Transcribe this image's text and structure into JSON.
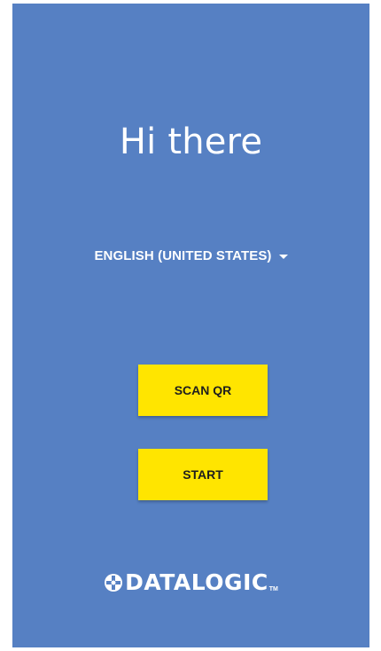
{
  "greeting": {
    "title": "Hi there"
  },
  "language_selector": {
    "value": "ENGLISH (UNITED STATES)"
  },
  "buttons": {
    "scan_qr": "SCAN QR",
    "start": "START"
  },
  "brand": {
    "logo_text": "DATALOGIC",
    "trademark": "TM",
    "icon": "datalogic-logo-mark"
  },
  "colors": {
    "background": "#5680c3",
    "button": "#ffe500",
    "button_text": "#1e1e1e",
    "text": "#ffffff"
  }
}
